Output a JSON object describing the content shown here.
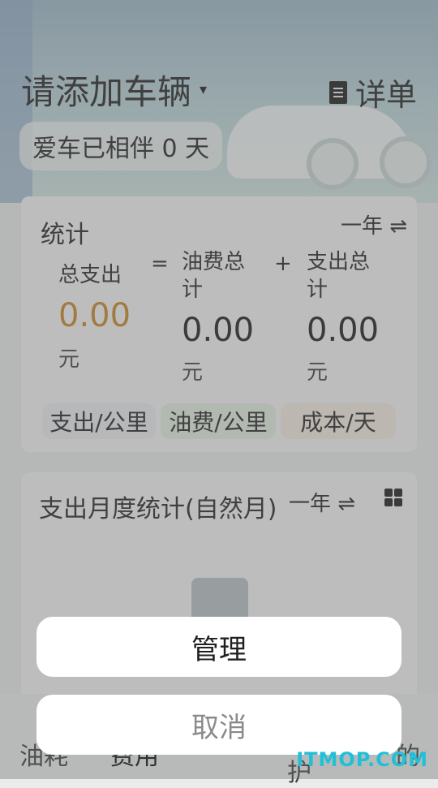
{
  "header": {
    "title": "请添加车辆",
    "caret": "▾",
    "detail_label": "详单",
    "days_text": "爱车已相伴 0 天"
  },
  "stats": {
    "title": "统计",
    "period": "一年 ⇌",
    "total_label": "总支出",
    "total_value": "0.00",
    "total_unit": "元",
    "equals": "=",
    "fuel_label_1": "油费总",
    "fuel_label_2": "计",
    "fuel_value": "0.00",
    "fuel_unit": "元",
    "plus": "+",
    "expense_label_1": "支出总",
    "expense_label_2": "计",
    "expense_value": "0.00",
    "expense_unit": "元",
    "chips": [
      "支出/公里",
      "油费/公里",
      "成本/天"
    ]
  },
  "monthly": {
    "title": "支出月度统计(自然月)",
    "period": "一年 ⇌"
  },
  "nav": {
    "tab_fuel": "油耗",
    "tab_cost": "费用",
    "tab_partial": "护",
    "tab_partial2": "的"
  },
  "sheet": {
    "manage_label": "管理",
    "cancel_label": "取消"
  },
  "watermark": "ITMOP.COM",
  "colors": {
    "accent_total": "#c98a2e",
    "chip1": "#e8ecef",
    "chip2": "#e2eee0",
    "chip3": "#f3ebe1"
  }
}
